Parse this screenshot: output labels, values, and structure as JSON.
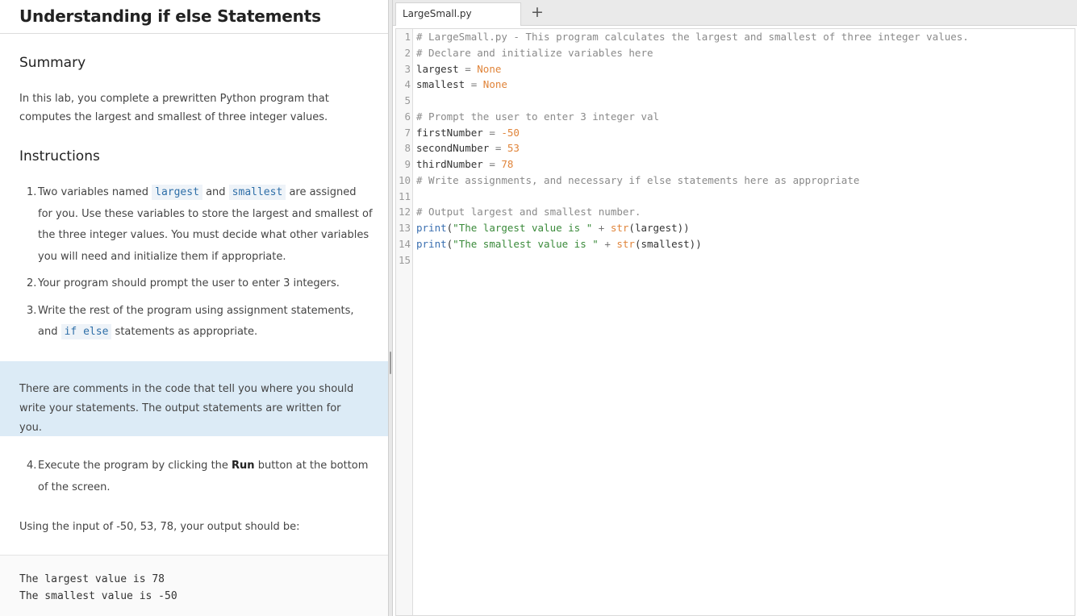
{
  "lesson": {
    "title": "Understanding if else Statements",
    "summary_heading": "Summary",
    "summary_lines": [
      "In this lab, you complete a prewritten Python program that",
      "computes the largest and smallest of three integer values."
    ],
    "instructions_heading": "Instructions",
    "step1": {
      "num": "1.",
      "pre": "Two variables named",
      "code_a": "largest",
      "mid": "and",
      "code_b": "smallest",
      "post": "are assigned",
      "l2": "for you. Use these variables to store the largest and smallest of",
      "l3": "the three integer values. You must decide what other variables",
      "l4": "you will need and initialize them if appropriate."
    },
    "step2": {
      "num": "2.",
      "text": "Your program should prompt the user to enter 3 integers."
    },
    "step3": {
      "num": "3.",
      "l1": "Write the rest of the program using assignment statements,",
      "pre": "and",
      "code": "if else",
      "post": "statements as appropriate."
    },
    "callout_lines": [
      "There are comments in the code that tell you where you should",
      "write your statements. The output statements are written for you."
    ],
    "step4": {
      "num": "4.",
      "pre": "Execute the program by clicking the",
      "bold": "Run",
      "post": "button at the bottom",
      "l2": "of the screen."
    },
    "expected_intro": "Using the input of -50, 53, 78, your output should be:",
    "expected_output": [
      "The largest value is 78",
      "The smallest value is -50"
    ]
  },
  "editor": {
    "tab_label": "LargeSmall.py",
    "add_tab_symbol": "+",
    "line_numbers": [
      "1",
      "2",
      "3",
      "4",
      "5",
      "6",
      "7",
      "8",
      "9",
      "10",
      "11",
      "12",
      "13",
      "14",
      "15"
    ],
    "code": {
      "l1": "# LargeSmall.py - This program calculates the largest and smallest of three integer values.",
      "l2": "# Declare and initialize variables here",
      "l3_name": "largest",
      "l3_op": " = ",
      "l3_val": "None",
      "l4_name": "smallest",
      "l4_op": " = ",
      "l4_val": "None",
      "l6": "# Prompt the user to enter 3 integer val",
      "l7_name": "firstNumber",
      "l7_op": " = ",
      "l7_val": "-50",
      "l8_name": "secondNumber",
      "l8_op": " = ",
      "l8_val": "53",
      "l9_name": "thirdNumber",
      "l9_op": " = ",
      "l9_val": "78",
      "l10": "# Write assignments, and necessary if else statements here as appropriate",
      "l12": "# Output largest and smallest number.",
      "l13_fn": "print",
      "l13_open": "(",
      "l13_str": "\"The largest value is \"",
      "l13_plus": " + ",
      "l13_fn2": "str",
      "l13_rest": "(largest))",
      "l14_fn": "print",
      "l14_open": "(",
      "l14_str": "\"The smallest value is \"",
      "l14_plus": " + ",
      "l14_fn2": "str",
      "l14_rest": "(smallest))"
    }
  },
  "colors": {
    "callout_bg": "#dcebf6",
    "inline_code": "#2f6fa8",
    "comment": "#8a8a8a",
    "keyword_number": "#e0843a",
    "string": "#3a8a3a",
    "function": "#3a6fb0"
  }
}
